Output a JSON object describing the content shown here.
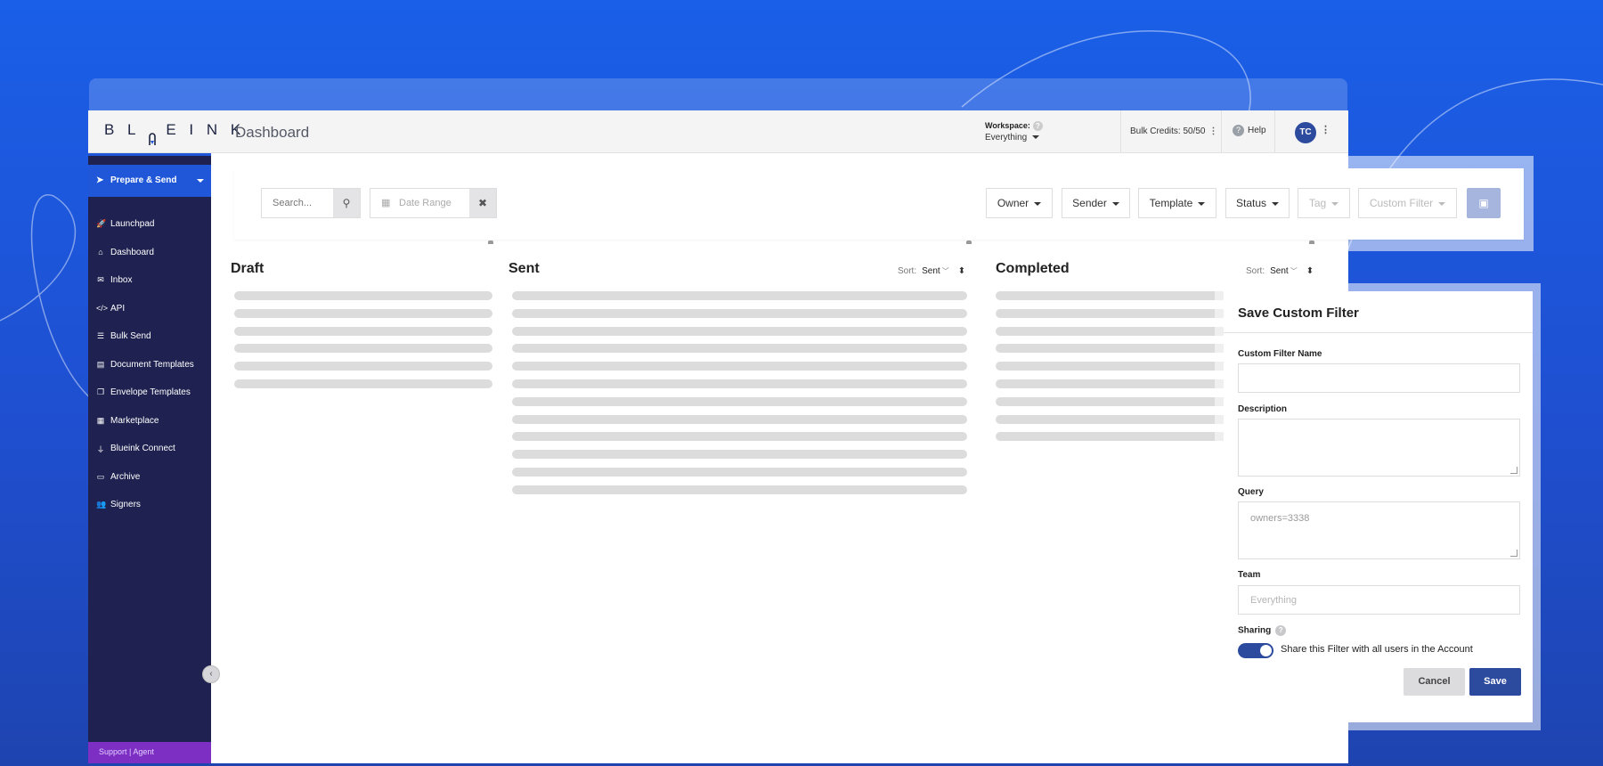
{
  "brand": {
    "logo_text": "BL EINK"
  },
  "header": {
    "page_title": "Dashboard",
    "workspace_label": "Workspace:",
    "workspace_value": "Everything",
    "bulk_credits": "Bulk Credits: 50/50",
    "help": "Help",
    "avatar_initials": "TC"
  },
  "sidebar": {
    "primary_action": "Prepare & Send",
    "items": [
      {
        "label": "Launchpad",
        "icon": "rocket-icon",
        "glyph": "🚀"
      },
      {
        "label": "Dashboard",
        "icon": "home-icon",
        "glyph": "⌂"
      },
      {
        "label": "Inbox",
        "icon": "envelope-icon",
        "glyph": "✉"
      },
      {
        "label": "API",
        "icon": "code-icon",
        "glyph": "</>"
      },
      {
        "label": "Bulk Send",
        "icon": "list-icon",
        "glyph": "☰"
      },
      {
        "label": "Document Templates",
        "icon": "file-icon",
        "glyph": "▤"
      },
      {
        "label": "Envelope Templates",
        "icon": "copy-icon",
        "glyph": "❐"
      },
      {
        "label": "Marketplace",
        "icon": "grid-icon",
        "glyph": "▦"
      },
      {
        "label": "Blueink Connect",
        "icon": "plug-icon",
        "glyph": "⏚"
      },
      {
        "label": "Archive",
        "icon": "archive-icon",
        "glyph": "▭"
      },
      {
        "label": "Signers",
        "icon": "users-icon",
        "glyph": "👥"
      }
    ],
    "support": "Support | Agent"
  },
  "filters": {
    "search_placeholder": "Search...",
    "date_range": "Date Range",
    "owner": "Owner",
    "sender": "Sender",
    "template": "Template",
    "status": "Status",
    "tag": "Tag",
    "custom_filter": "Custom Filter"
  },
  "columns": {
    "draft": {
      "title": "Draft"
    },
    "sent": {
      "title": "Sent",
      "sort_label": "Sort:",
      "sort_value": "Sent"
    },
    "completed": {
      "title": "Completed",
      "sort_label": "Sort:",
      "sort_value": "Sent"
    }
  },
  "modal": {
    "title": "Save Custom Filter",
    "name_label": "Custom Filter Name",
    "name_value": "",
    "description_label": "Description",
    "description_value": "",
    "query_label": "Query",
    "query_value": "owners=3338",
    "team_label": "Team",
    "team_value": "Everything",
    "sharing_label": "Sharing",
    "sharing_enabled": true,
    "share_text": "Share this Filter with all users in the Account",
    "cancel": "Cancel",
    "save": "Save"
  },
  "colors": {
    "background": "#1a5fe8",
    "sidebar": "#1f2250",
    "primary_action": "#1f57d8",
    "accent": "#2c4a9e",
    "support_bar": "#7d2fc4"
  }
}
